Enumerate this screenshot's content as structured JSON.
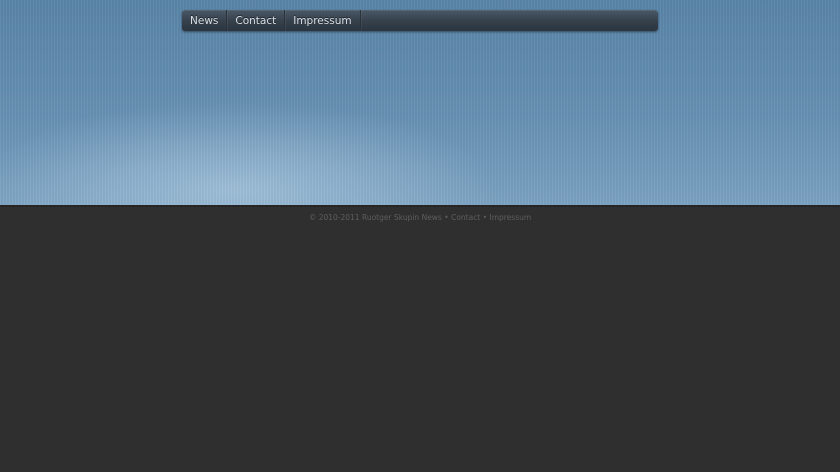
{
  "nav": {
    "items": [
      {
        "label": "News"
      },
      {
        "label": "Contact"
      },
      {
        "label": "Impressum"
      }
    ]
  },
  "footer": {
    "copyright": "© 2010-2011 Ruotger Skupin",
    "links": [
      {
        "label": "News"
      },
      {
        "label": "Contact"
      },
      {
        "label": "Impressum"
      }
    ],
    "separator": "•"
  },
  "colors": {
    "header_top": "#5a85a8",
    "header_bottom": "#7ca3c2",
    "page_background": "#2f2f2f",
    "navbar": "#35404b"
  }
}
